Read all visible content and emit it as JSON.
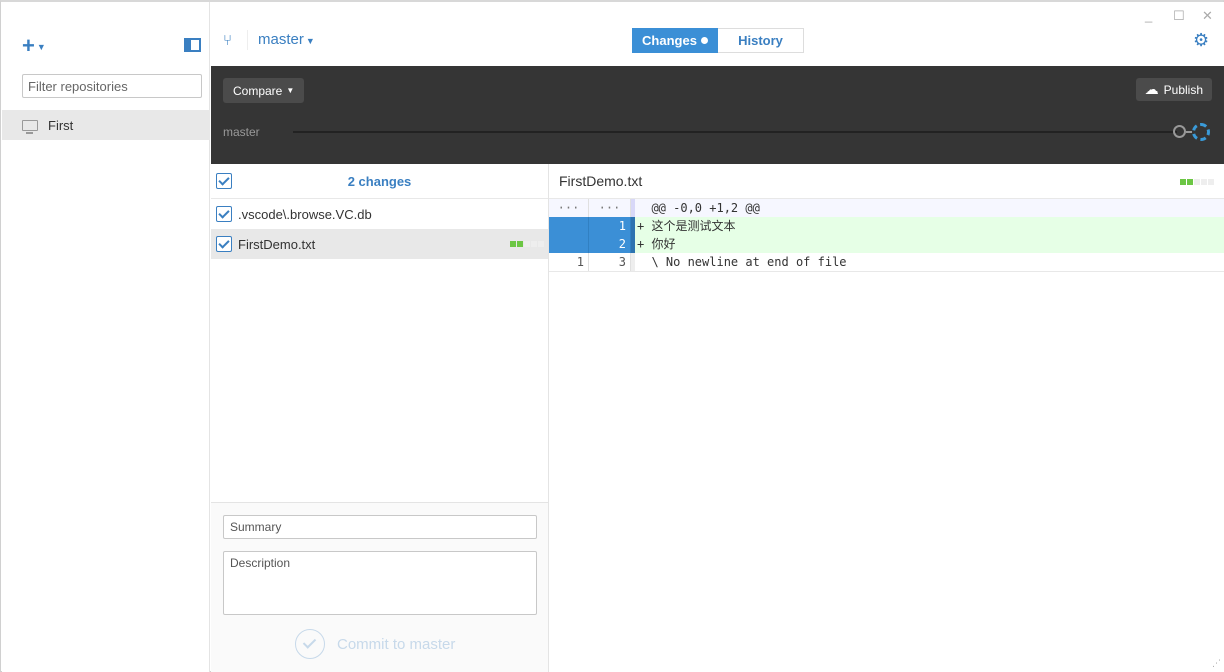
{
  "sidebar": {
    "add_label": "+",
    "filter_placeholder": "Filter repositories",
    "repositories": [
      {
        "name": "First",
        "icon": "monitor-icon"
      }
    ]
  },
  "header": {
    "branch": "master",
    "tabs": [
      {
        "label": "Changes",
        "active": true
      },
      {
        "label": "History",
        "active": false
      }
    ],
    "window_controls": [
      "minimize",
      "maximize",
      "close"
    ]
  },
  "toolbar": {
    "compare_label": "Compare",
    "publish_label": "Publish",
    "timeline_branch": "master"
  },
  "changes": {
    "count_label": "2 changes",
    "files": [
      {
        "name": ".vscode\\.browse.VC.db",
        "checked": true,
        "selected": false
      },
      {
        "name": "FirstDemo.txt",
        "checked": true,
        "selected": true,
        "diffstat": {
          "added": 2,
          "total": 5
        }
      }
    ]
  },
  "commit": {
    "summary_placeholder": "Summary",
    "description_placeholder": "Description",
    "button_label": "Commit to master"
  },
  "diff": {
    "file_name": "FirstDemo.txt",
    "diffstat": {
      "added": 2,
      "total": 5
    },
    "lines": [
      {
        "type": "hunk",
        "old": "···",
        "new": "···",
        "text": "  @@ -0,0 +1,2 @@"
      },
      {
        "type": "added",
        "old": "",
        "new": "1",
        "text": "+ 这个是测试文本"
      },
      {
        "type": "added",
        "old": "",
        "new": "2",
        "text": "+ 你好"
      },
      {
        "type": "context",
        "old": "1",
        "new": "3",
        "text": "  \\ No newline at end of file"
      }
    ]
  }
}
